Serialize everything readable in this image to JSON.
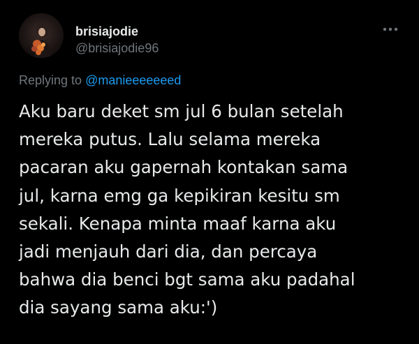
{
  "user": {
    "display_name": "brisiajodie",
    "handle": "@brisiajodie96"
  },
  "reply": {
    "prefix": "Replying to ",
    "mention": "@manieeeeeeed"
  },
  "tweet": {
    "lines": [
      "Aku baru deket sm jul 6 bulan setelah",
      "mereka putus. Lalu selama mereka",
      "pacaran aku gapernah kontakan sama",
      "jul, karna emg ga kepikiran kesitu sm",
      "sekali. Kenapa minta maaf karna aku",
      "jadi menjauh dari dia, dan percaya",
      "bahwa dia benci bgt sama aku padahal",
      "dia sayang sama aku:')"
    ]
  },
  "icons": {
    "more": "more-dots-icon",
    "avatar": "profile-photo"
  },
  "colors": {
    "background": "#000000",
    "primary_text": "#e7e9ea",
    "secondary_text": "#71767b",
    "link": "#1d9bf0"
  }
}
